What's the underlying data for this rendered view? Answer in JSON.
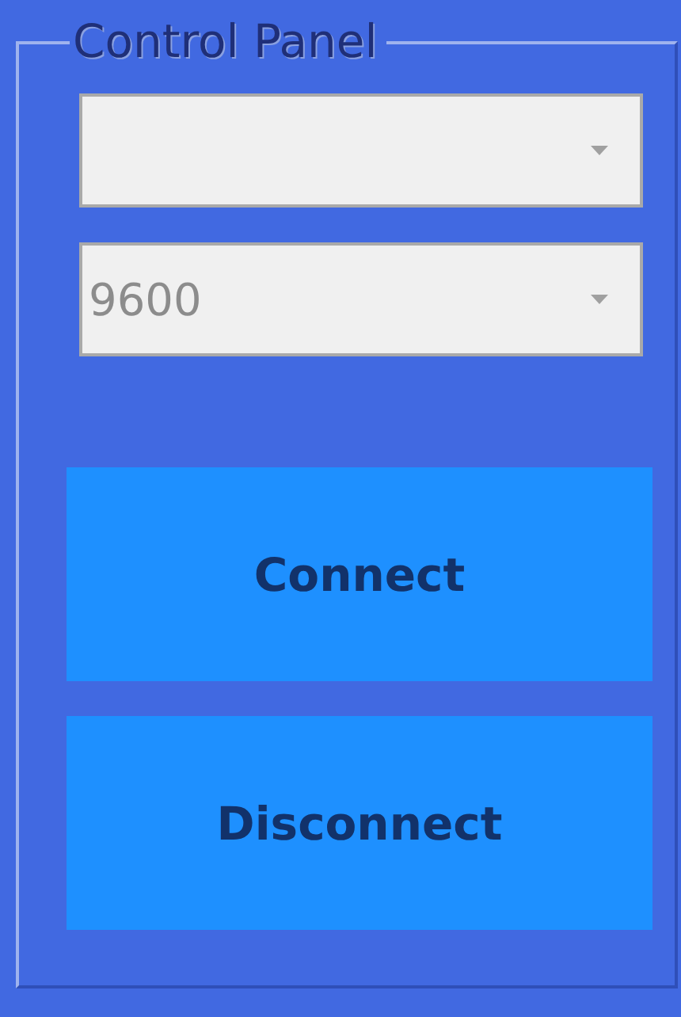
{
  "group": {
    "title": "Control Panel"
  },
  "dropdowns": [
    {
      "kind": "dropdown"
    },
    {
      "kind": "dropdown",
      "value": "9600"
    }
  ],
  "buttons": [
    {
      "label": "Connect"
    },
    {
      "label": "Disconnect"
    }
  ]
}
